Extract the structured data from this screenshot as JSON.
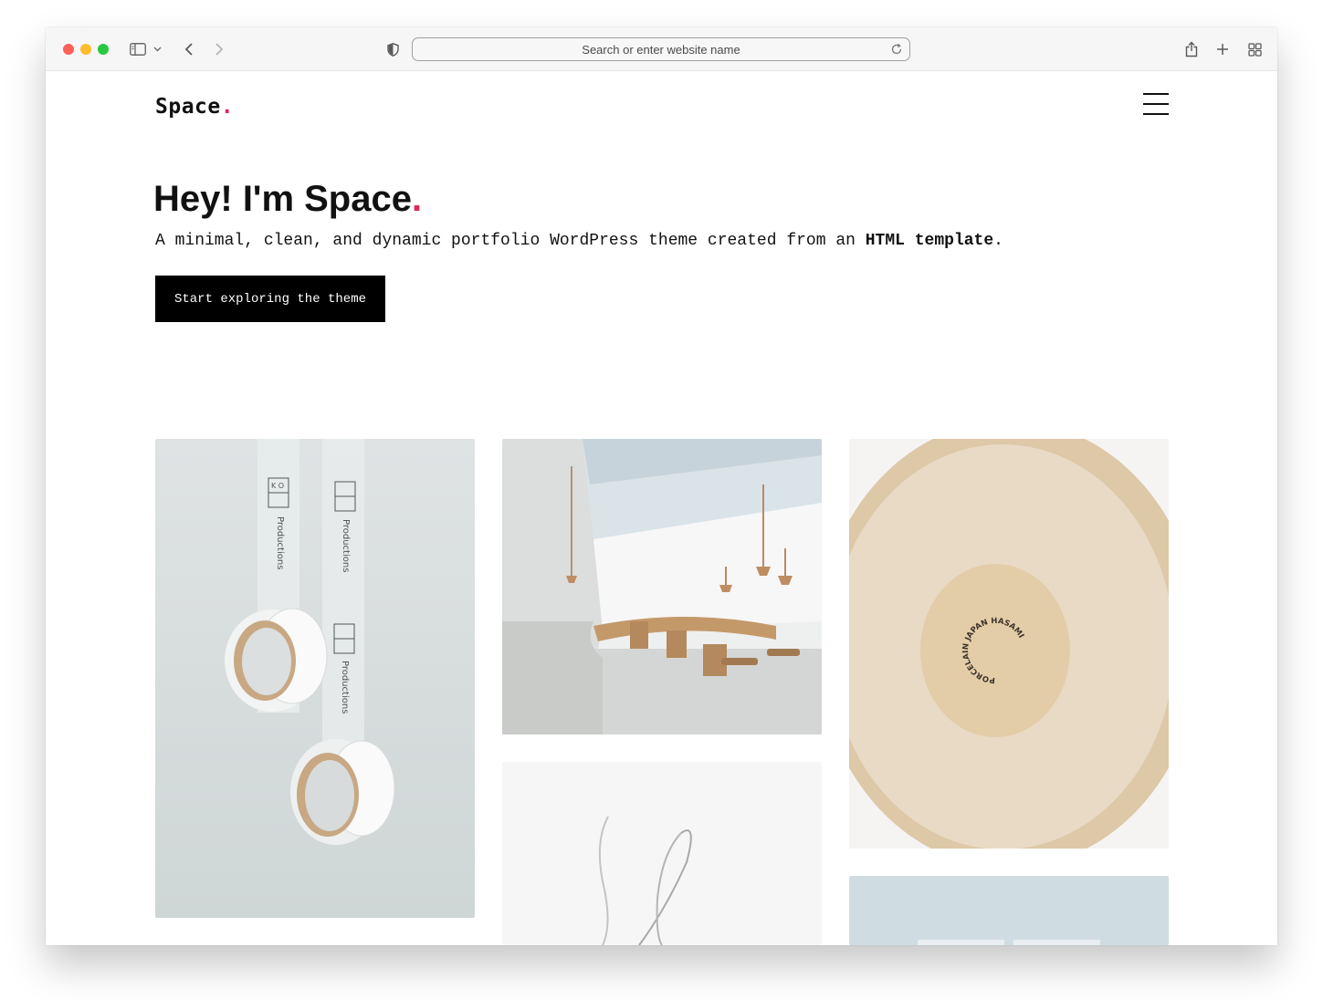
{
  "browser": {
    "address_placeholder": "Search or enter website name"
  },
  "site": {
    "logo_text": "Space",
    "logo_dot": "."
  },
  "hero": {
    "title_prefix": "Hey! I'm ",
    "title_bold": "Space",
    "title_dot": ".",
    "subtitle_plain": "A minimal, clean, and dynamic portfolio WordPress theme created from an ",
    "subtitle_bold": "HTML template",
    "subtitle_end": ".",
    "cta_label": "Start exploring the theme"
  },
  "gallery": {
    "tape_brand_top": "K O",
    "tape_text": "Productions",
    "bowl_stamp": "PORCELAIN JAPAN HASAMI"
  },
  "colors": {
    "accent": "#e2245a",
    "button_bg": "#000000",
    "text": "#111111"
  }
}
